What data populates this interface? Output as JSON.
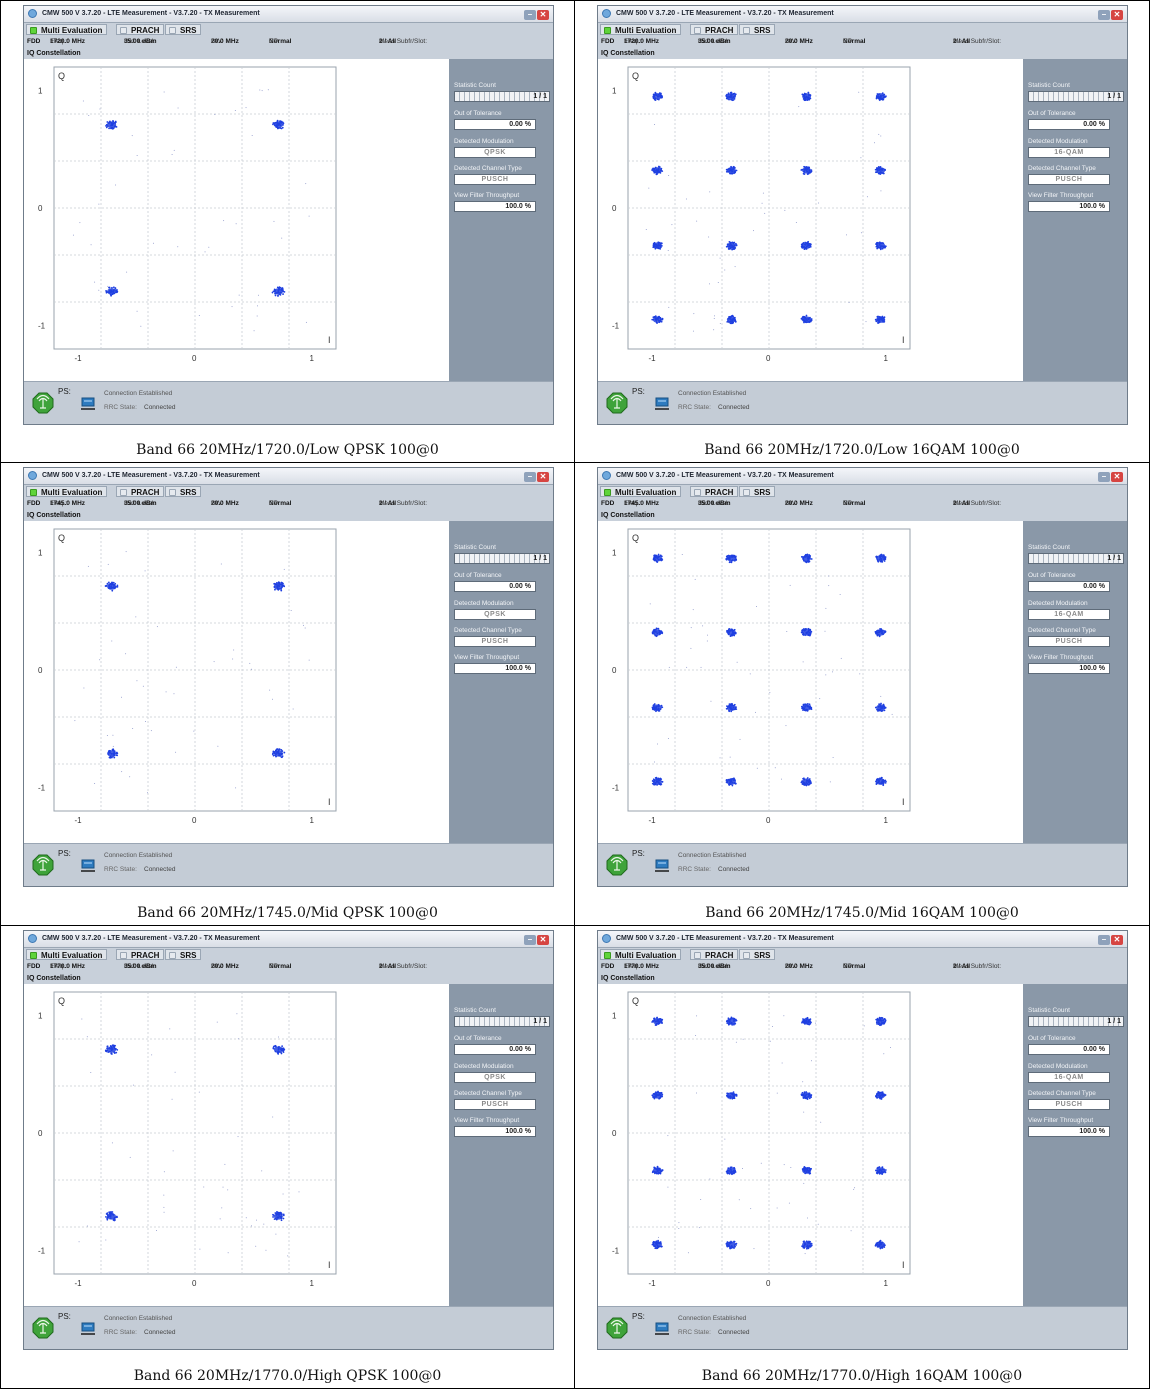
{
  "window": {
    "title": "CMW 500 V 3.7.20 - LTE Measurement - V3.7.20 - TX Measurement",
    "min_symbol": "–",
    "close_symbol": "✕"
  },
  "tabs": [
    {
      "label": "Multi Evaluation",
      "active": true
    },
    {
      "label": "PRACH",
      "active": false
    },
    {
      "label": "SRS",
      "active": false
    }
  ],
  "info": {
    "duplex": "FDD",
    "freq_label": "Freq.:",
    "ref_label": "Ref. Level:",
    "ref_value": "35.00 dBm",
    "bw_label": "BW:",
    "bw_value": "20.0 MHz",
    "cp_label": "CP:",
    "cp_value": "Normal",
    "subfr_label": "Meas Subfr/Slot:",
    "subfr_value": "2 / All"
  },
  "section_title": "IQ Constellation",
  "axes": {
    "q_label": "Q",
    "i_label": "I",
    "y_ticks": [
      "1",
      "0",
      "-1"
    ],
    "x_ticks": [
      "-1",
      "0",
      "1"
    ]
  },
  "side_labels": {
    "statistic_count": "Statistic Count",
    "out_of_tolerance": "Out of Tolerance",
    "detected_modulation": "Detected Modulation",
    "detected_channel_type": "Detected Channel Type",
    "view_filter_throughput": "View Filter Throughput"
  },
  "side_values": {
    "statistic_count": "1 / 1",
    "out_of_tolerance": "0.00 %",
    "channel_type": "PUSCH",
    "throughput": "100.0 %"
  },
  "status": {
    "ps_label": "PS:",
    "connection": "Connection Established",
    "rrc_label": "RRC State:",
    "rrc_value": "Connected"
  },
  "colors": {
    "constellation_points": "#1f3fe0",
    "panel_bg": "#8a98a8",
    "led_active": "#5fd43a"
  },
  "panels": [
    {
      "freq": "1720.0 MHz",
      "modulation": "QPSK",
      "caption": "Band 66 20MHz/1720.0/Low QPSK 100@0"
    },
    {
      "freq": "1720.0 MHz",
      "modulation": "16-QAM",
      "caption": "Band 66 20MHz/1720.0/Low 16QAM 100@0"
    },
    {
      "freq": "1745.0 MHz",
      "modulation": "QPSK",
      "caption": "Band 66 20MHz/1745.0/Mid QPSK 100@0"
    },
    {
      "freq": "1745.0 MHz",
      "modulation": "16-QAM",
      "caption": "Band 66 20MHz/1745.0/Mid 16QAM 100@0"
    },
    {
      "freq": "1770.0 MHz",
      "modulation": "QPSK",
      "caption": "Band 66 20MHz/1770.0/High QPSK 100@0"
    },
    {
      "freq": "1770.0 MHz",
      "modulation": "16-QAM",
      "caption": "Band 66 20MHz/1770.0/High 16QAM 100@0"
    }
  ],
  "chart_data": [
    {
      "type": "scatter",
      "title": "IQ Constellation",
      "xlabel": "I",
      "ylabel": "Q",
      "xlim": [
        -1.2,
        1.2
      ],
      "ylim": [
        -1.2,
        1.2
      ],
      "grid": true,
      "clusters": {
        "x": [
          -0.71,
          0.71,
          -0.71,
          0.71
        ],
        "y": [
          0.71,
          0.71,
          -0.71,
          -0.71
        ]
      }
    },
    {
      "type": "scatter",
      "title": "IQ Constellation",
      "xlabel": "I",
      "ylabel": "Q",
      "xlim": [
        -1.2,
        1.2
      ],
      "ylim": [
        -1.2,
        1.2
      ],
      "grid": true,
      "clusters": {
        "x": [
          -0.95,
          -0.32,
          0.32,
          0.95,
          -0.95,
          -0.32,
          0.32,
          0.95,
          -0.95,
          -0.32,
          0.32,
          0.95,
          -0.95,
          -0.32,
          0.32,
          0.95
        ],
        "y": [
          0.95,
          0.95,
          0.95,
          0.95,
          0.32,
          0.32,
          0.32,
          0.32,
          -0.32,
          -0.32,
          -0.32,
          -0.32,
          -0.95,
          -0.95,
          -0.95,
          -0.95
        ]
      }
    },
    {
      "type": "scatter",
      "title": "IQ Constellation",
      "xlabel": "I",
      "ylabel": "Q",
      "xlim": [
        -1.2,
        1.2
      ],
      "ylim": [
        -1.2,
        1.2
      ],
      "grid": true,
      "clusters": {
        "x": [
          -0.71,
          0.71,
          -0.71,
          0.71
        ],
        "y": [
          0.71,
          0.71,
          -0.71,
          -0.71
        ]
      }
    },
    {
      "type": "scatter",
      "title": "IQ Constellation",
      "xlabel": "I",
      "ylabel": "Q",
      "xlim": [
        -1.2,
        1.2
      ],
      "ylim": [
        -1.2,
        1.2
      ],
      "grid": true,
      "clusters": {
        "x": [
          -0.95,
          -0.32,
          0.32,
          0.95,
          -0.95,
          -0.32,
          0.32,
          0.95,
          -0.95,
          -0.32,
          0.32,
          0.95,
          -0.95,
          -0.32,
          0.32,
          0.95
        ],
        "y": [
          0.95,
          0.95,
          0.95,
          0.95,
          0.32,
          0.32,
          0.32,
          0.32,
          -0.32,
          -0.32,
          -0.32,
          -0.32,
          -0.95,
          -0.95,
          -0.95,
          -0.95
        ]
      }
    },
    {
      "type": "scatter",
      "title": "IQ Constellation",
      "xlabel": "I",
      "ylabel": "Q",
      "xlim": [
        -1.2,
        1.2
      ],
      "ylim": [
        -1.2,
        1.2
      ],
      "grid": true,
      "clusters": {
        "x": [
          -0.71,
          0.71,
          -0.71,
          0.71
        ],
        "y": [
          0.71,
          0.71,
          -0.71,
          -0.71
        ]
      }
    },
    {
      "type": "scatter",
      "title": "IQ Constellation",
      "xlabel": "I",
      "ylabel": "Q",
      "xlim": [
        -1.2,
        1.2
      ],
      "ylim": [
        -1.2,
        1.2
      ],
      "grid": true,
      "clusters": {
        "x": [
          -0.95,
          -0.32,
          0.32,
          0.95,
          -0.95,
          -0.32,
          0.32,
          0.95,
          -0.95,
          -0.32,
          0.32,
          0.95,
          -0.95,
          -0.32,
          0.32,
          0.95
        ],
        "y": [
          0.95,
          0.95,
          0.95,
          0.95,
          0.32,
          0.32,
          0.32,
          0.32,
          -0.32,
          -0.32,
          -0.32,
          -0.32,
          -0.95,
          -0.95,
          -0.95,
          -0.95
        ]
      }
    }
  ]
}
